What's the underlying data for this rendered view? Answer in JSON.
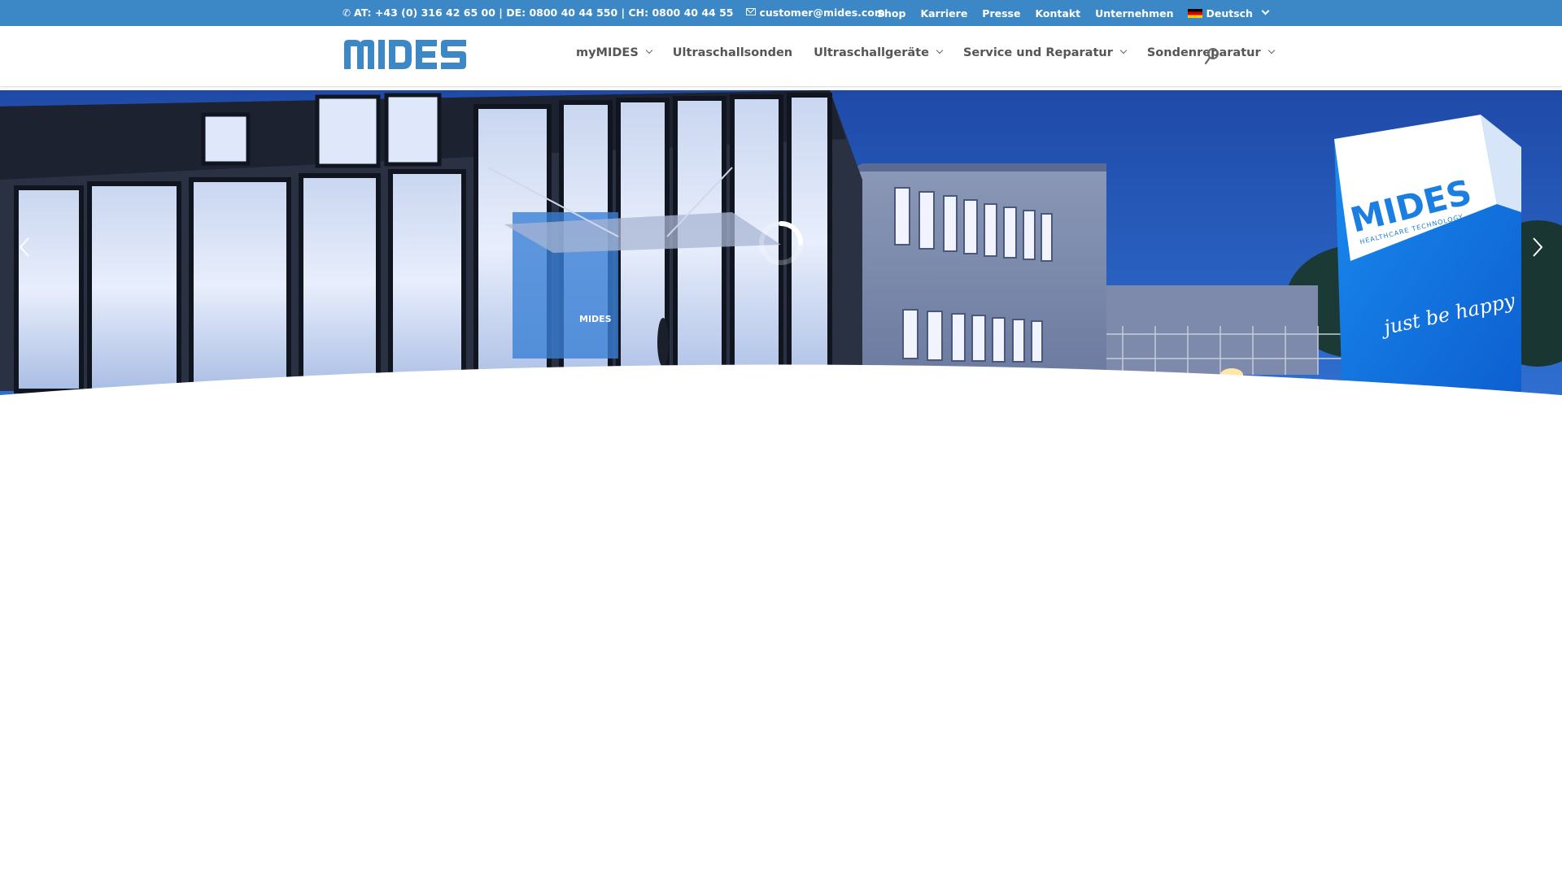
{
  "topbar": {
    "phone_text": "AT: +43 (0) 316 42 65 00 | DE: 0800 40 44 550 | CH: 0800 40 44 55",
    "email": "customer@mides.com",
    "links": [
      "Shop",
      "Karriere",
      "Presse",
      "Kontakt",
      "Unternehmen"
    ],
    "language": "Deutsch",
    "background_color": "#3c88c6"
  },
  "header": {
    "logo_text": "MIDES",
    "nav": [
      {
        "label": "myMIDES",
        "has_dropdown": true
      },
      {
        "label": "Ultraschallsonden",
        "has_dropdown": false
      },
      {
        "label": "Ultraschallgeräte",
        "has_dropdown": true
      },
      {
        "label": "Service und Reparatur",
        "has_dropdown": true
      },
      {
        "label": "Sondenreparatur",
        "has_dropdown": true
      }
    ],
    "search_icon": "search-icon",
    "brand_color": "#3c88c6"
  },
  "hero": {
    "sign_brand": "MIDES",
    "sign_subtitle": "HEALTHCARE TECHNOLOGY",
    "sign_slogan": "just be happy",
    "window_brand": "MIDES",
    "prev_icon": "chevron-left-icon",
    "next_icon": "chevron-right-icon",
    "loader_icon": "loading-spinner-icon"
  }
}
